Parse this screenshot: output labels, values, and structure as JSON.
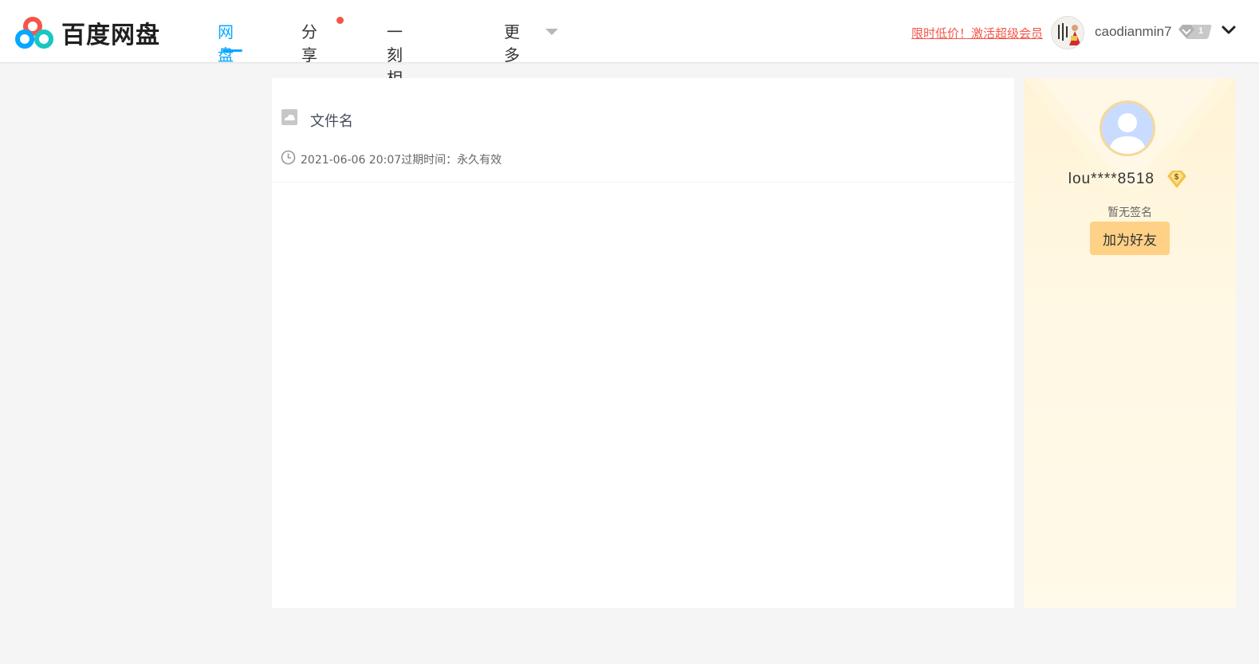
{
  "brand": {
    "name": "百度网盘",
    "colors": {
      "blue": "#06a7ff",
      "red": "#f5564a",
      "teal": "#18c6c2"
    }
  },
  "nav": {
    "items": [
      {
        "label": "网盘",
        "active": true
      },
      {
        "label": "分享",
        "has_notification": true
      },
      {
        "label": "一刻相册"
      },
      {
        "label": "更多",
        "has_dropdown": true
      }
    ]
  },
  "header": {
    "vip_promo": "限时低价！激活超级会员",
    "username": "caodianmin7",
    "level": "1",
    "icons": [
      "user-avatar-icon",
      "level-badge-icon",
      "chevron-down-icon"
    ]
  },
  "file": {
    "name": "文件名",
    "share_time": "2021-06-06 20:07",
    "expire_label": "过期时间：",
    "expire_value": "永久有效",
    "icons": [
      "file-image-icon",
      "clock-icon"
    ]
  },
  "profile": {
    "display_name": "lou****8518",
    "signature": "暂无签名",
    "add_friend_label": "加为好友",
    "icons": [
      "default-avatar-icon",
      "diamond-icon"
    ]
  }
}
